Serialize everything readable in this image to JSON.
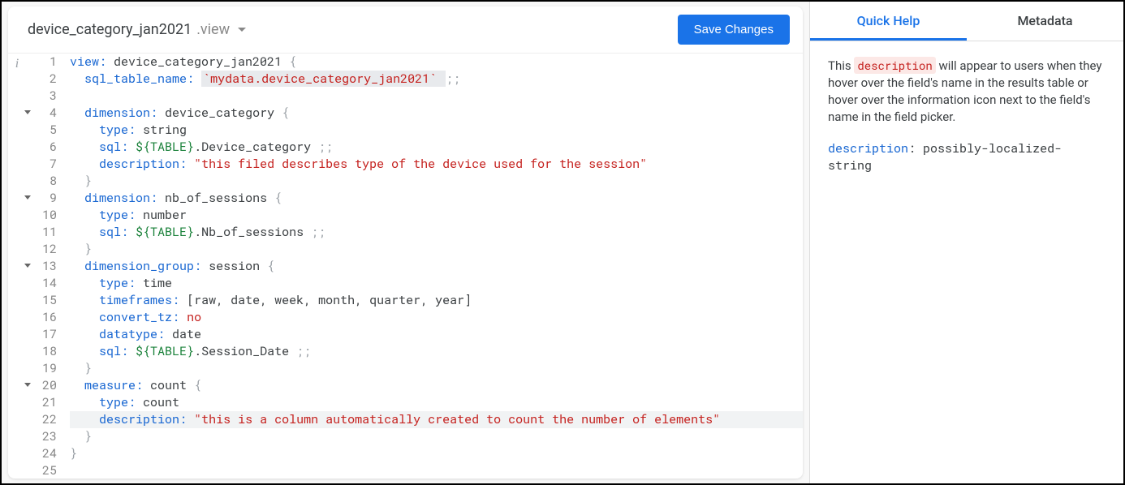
{
  "file": {
    "name": "device_category_jan2021",
    "ext": ".view"
  },
  "toolbar": {
    "save_label": "Save Changes"
  },
  "gutter": {
    "info_glyph": "i",
    "fold_lines": [
      4,
      9,
      13,
      20
    ]
  },
  "code": {
    "highlight_line": 22,
    "lines": [
      {
        "n": 1,
        "tokens": [
          [
            "kw",
            "view:"
          ],
          [
            "sp",
            " "
          ],
          [
            "id",
            "device_category_jan2021"
          ],
          [
            "sp",
            " "
          ],
          [
            "punct",
            "{"
          ]
        ]
      },
      {
        "n": 2,
        "tokens": [
          [
            "sp",
            "  "
          ],
          [
            "kw",
            "sql_table_name:"
          ],
          [
            "sp",
            " "
          ],
          [
            "hl_start"
          ],
          [
            "str",
            "`mydata.device_category_jan2021`"
          ],
          [
            "sp",
            " "
          ],
          [
            "hl_end"
          ],
          [
            "punct",
            ";;"
          ]
        ]
      },
      {
        "n": 3,
        "tokens": []
      },
      {
        "n": 4,
        "tokens": [
          [
            "sp",
            "  "
          ],
          [
            "kw",
            "dimension:"
          ],
          [
            "sp",
            " "
          ],
          [
            "id",
            "device_category"
          ],
          [
            "sp",
            " "
          ],
          [
            "punct",
            "{"
          ]
        ]
      },
      {
        "n": 5,
        "tokens": [
          [
            "sp",
            "    "
          ],
          [
            "kw",
            "type:"
          ],
          [
            "sp",
            " "
          ],
          [
            "id",
            "string"
          ]
        ]
      },
      {
        "n": 6,
        "tokens": [
          [
            "sp",
            "    "
          ],
          [
            "kw",
            "sql:"
          ],
          [
            "sp",
            " "
          ],
          [
            "tbl",
            "${TABLE}"
          ],
          [
            "id",
            ".Device_category"
          ],
          [
            "sp",
            " "
          ],
          [
            "punct",
            ";;"
          ]
        ]
      },
      {
        "n": 7,
        "tokens": [
          [
            "sp",
            "    "
          ],
          [
            "kw",
            "description:"
          ],
          [
            "sp",
            " "
          ],
          [
            "str",
            "\"this filed describes type of the device used for the session\""
          ]
        ]
      },
      {
        "n": 8,
        "tokens": [
          [
            "sp",
            "  "
          ],
          [
            "punct",
            "}"
          ]
        ]
      },
      {
        "n": 9,
        "tokens": [
          [
            "sp",
            "  "
          ],
          [
            "kw",
            "dimension:"
          ],
          [
            "sp",
            " "
          ],
          [
            "id",
            "nb_of_sessions"
          ],
          [
            "sp",
            " "
          ],
          [
            "punct",
            "{"
          ]
        ]
      },
      {
        "n": 10,
        "tokens": [
          [
            "sp",
            "    "
          ],
          [
            "kw",
            "type:"
          ],
          [
            "sp",
            " "
          ],
          [
            "id",
            "number"
          ]
        ]
      },
      {
        "n": 11,
        "tokens": [
          [
            "sp",
            "    "
          ],
          [
            "kw",
            "sql:"
          ],
          [
            "sp",
            " "
          ],
          [
            "tbl",
            "${TABLE}"
          ],
          [
            "id",
            ".Nb_of_sessions"
          ],
          [
            "sp",
            " "
          ],
          [
            "punct",
            ";;"
          ]
        ]
      },
      {
        "n": 12,
        "tokens": [
          [
            "sp",
            "  "
          ],
          [
            "punct",
            "}"
          ]
        ]
      },
      {
        "n": 13,
        "tokens": [
          [
            "sp",
            "  "
          ],
          [
            "kw",
            "dimension_group:"
          ],
          [
            "sp",
            " "
          ],
          [
            "id",
            "session"
          ],
          [
            "sp",
            " "
          ],
          [
            "punct",
            "{"
          ]
        ]
      },
      {
        "n": 14,
        "tokens": [
          [
            "sp",
            "    "
          ],
          [
            "kw",
            "type:"
          ],
          [
            "sp",
            " "
          ],
          [
            "id",
            "time"
          ]
        ]
      },
      {
        "n": 15,
        "tokens": [
          [
            "sp",
            "    "
          ],
          [
            "kw",
            "timeframes:"
          ],
          [
            "sp",
            " "
          ],
          [
            "id",
            "[raw, date, week, month, quarter, year]"
          ]
        ]
      },
      {
        "n": 16,
        "tokens": [
          [
            "sp",
            "    "
          ],
          [
            "kw",
            "convert_tz:"
          ],
          [
            "sp",
            " "
          ],
          [
            "no",
            "no"
          ]
        ]
      },
      {
        "n": 17,
        "tokens": [
          [
            "sp",
            "    "
          ],
          [
            "kw",
            "datatype:"
          ],
          [
            "sp",
            " "
          ],
          [
            "id",
            "date"
          ]
        ]
      },
      {
        "n": 18,
        "tokens": [
          [
            "sp",
            "    "
          ],
          [
            "kw",
            "sql:"
          ],
          [
            "sp",
            " "
          ],
          [
            "tbl",
            "${TABLE}"
          ],
          [
            "id",
            ".Session_Date"
          ],
          [
            "sp",
            " "
          ],
          [
            "punct",
            ";;"
          ]
        ]
      },
      {
        "n": 19,
        "tokens": [
          [
            "sp",
            "  "
          ],
          [
            "punct",
            "}"
          ]
        ]
      },
      {
        "n": 20,
        "tokens": [
          [
            "sp",
            "  "
          ],
          [
            "kw",
            "measure:"
          ],
          [
            "sp",
            " "
          ],
          [
            "id",
            "count"
          ],
          [
            "sp",
            " "
          ],
          [
            "punct",
            "{"
          ]
        ]
      },
      {
        "n": 21,
        "tokens": [
          [
            "sp",
            "    "
          ],
          [
            "kw",
            "type:"
          ],
          [
            "sp",
            " "
          ],
          [
            "id",
            "count"
          ]
        ]
      },
      {
        "n": 22,
        "tokens": [
          [
            "sp",
            "    "
          ],
          [
            "kw",
            "description:"
          ],
          [
            "sp",
            " "
          ],
          [
            "str",
            "\"this is a column automatically created to count the number of elements\""
          ]
        ]
      },
      {
        "n": 23,
        "tokens": [
          [
            "sp",
            "  "
          ],
          [
            "punct",
            "}"
          ]
        ]
      },
      {
        "n": 24,
        "tokens": [
          [
            "punct",
            "}"
          ]
        ]
      },
      {
        "n": 25,
        "tokens": []
      }
    ]
  },
  "sidebar": {
    "tabs": [
      {
        "label": "Quick Help",
        "active": true
      },
      {
        "label": "Metadata",
        "active": false
      }
    ],
    "help": {
      "prefix": "This ",
      "pill": "description",
      "suffix": " will appear to users when they hover over the field's name in the results table or hover over the information icon next to the field's name in the field picker.",
      "sig_key": "description",
      "sig_sep": ": ",
      "sig_val": "possibly-localized-string"
    }
  }
}
